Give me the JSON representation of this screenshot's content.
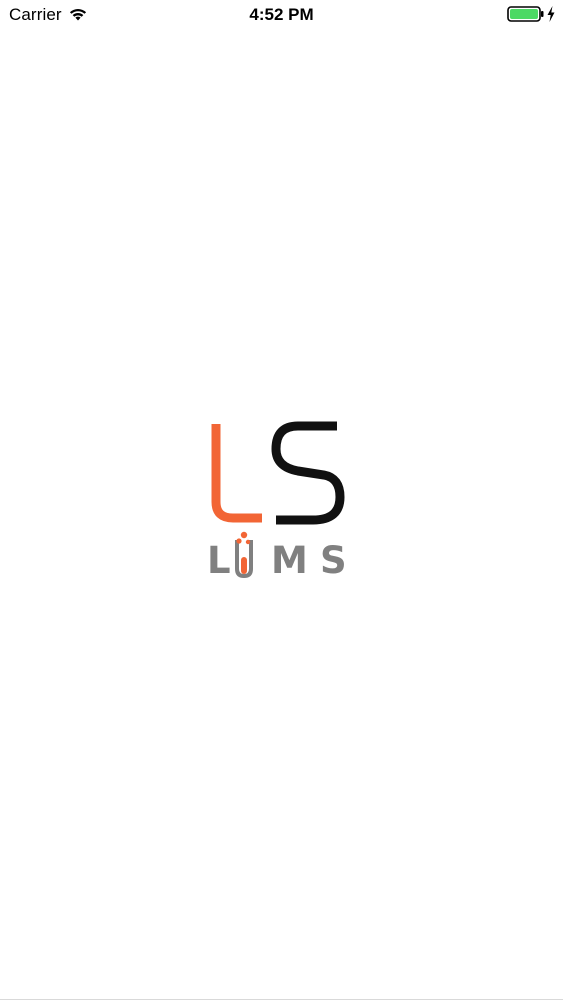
{
  "status_bar": {
    "carrier": "Carrier",
    "time": "4:52 PM",
    "wifi_icon": "wifi-icon",
    "battery_icon": "battery-icon",
    "charging_icon": "charging-bolt-icon",
    "battery_level": 1.0
  },
  "splash": {
    "logo_text_top": "LS",
    "logo_text_bottom": "LIMS",
    "logo_colors": {
      "orange": "#f26535",
      "black": "#111111",
      "gray": "#808080",
      "orange_dots": "#f26535"
    }
  },
  "colors": {
    "background": "#ffffff",
    "battery_green": "#4cd964"
  }
}
